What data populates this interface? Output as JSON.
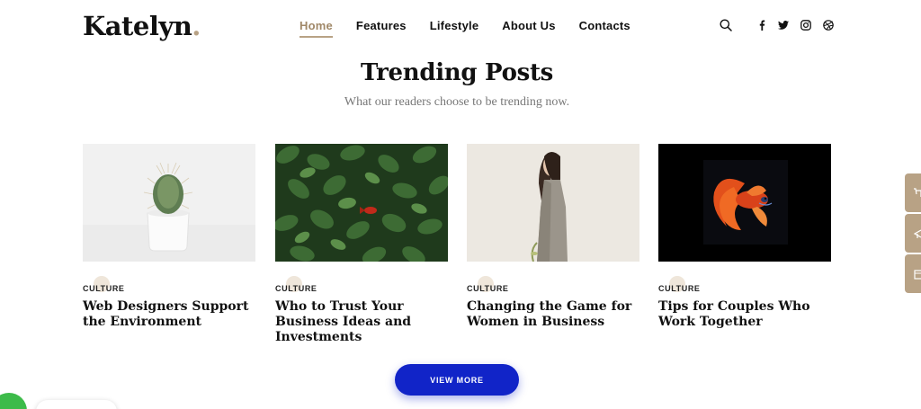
{
  "header": {
    "logo": "Katelyn",
    "logo_dot": ".",
    "nav": [
      {
        "label": "Home"
      },
      {
        "label": "Features"
      },
      {
        "label": "Lifestyle"
      },
      {
        "label": "About Us"
      },
      {
        "label": "Contacts"
      }
    ],
    "icons": [
      "search-icon",
      "facebook-icon",
      "twitter-icon",
      "instagram-icon",
      "dribbble-icon"
    ],
    "accent": "#b8a285"
  },
  "section": {
    "title": "Trending Posts",
    "subtitle": "What our readers choose to be trending now."
  },
  "posts": [
    {
      "category": "CULTURE",
      "title": "Web Designers Support the Environment",
      "image": "cactus in white pot"
    },
    {
      "category": "CULTURE",
      "title": "Who to Trust Your Business Ideas and Investments",
      "image": "green leaves with red fish"
    },
    {
      "category": "CULTURE",
      "title": "Changing the Game for Women in Business",
      "image": "woman in grey coat"
    },
    {
      "category": "CULTURE",
      "title": "Tips for Couples Who Work Together",
      "image": "red betta fish on black"
    }
  ],
  "actions": {
    "view_more": "VIEW MORE",
    "button_color": "#1124c8"
  }
}
